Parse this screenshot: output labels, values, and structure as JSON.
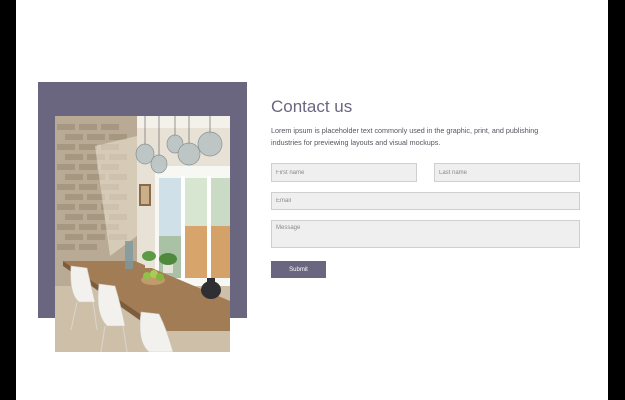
{
  "contact": {
    "title": "Contact us",
    "description": "Lorem ipsum is placeholder text commonly used in the graphic, print, and publishing industries for previewing layouts and visual mockups."
  },
  "form": {
    "first_name_placeholder": "First name",
    "last_name_placeholder": "Last name",
    "email_placeholder": "Email",
    "message_placeholder": "Message",
    "submit_label": "Submit"
  },
  "colors": {
    "accent": "#6a6680",
    "page_background": "#ffffff",
    "frame": "#000000",
    "field_background": "#efefef"
  }
}
